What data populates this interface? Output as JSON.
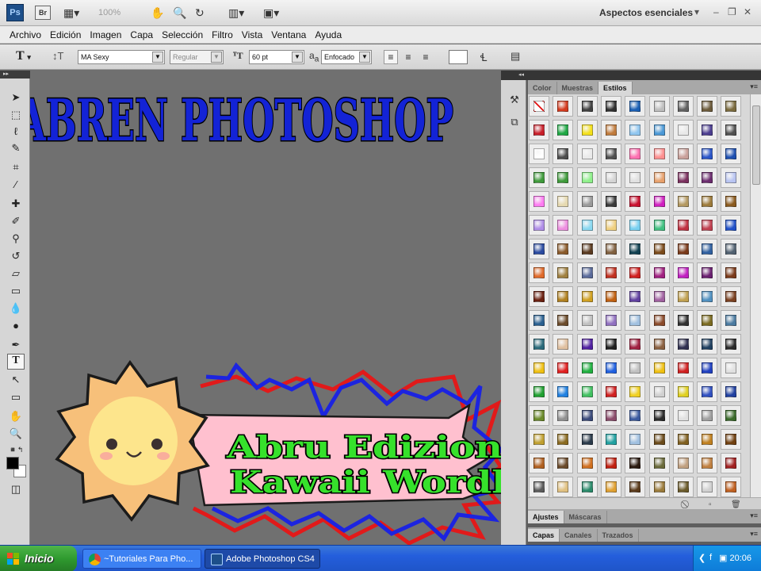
{
  "appbar": {
    "ps_logo": "Ps",
    "br_logo": "Br",
    "zoom": "100%",
    "workspace": "Aspectos esenciales",
    "icons": [
      "screen-mode-icon",
      "hand-icon",
      "zoom-icon",
      "rotate-view-icon",
      "arrange-documents-icon",
      "screen-mode-icon"
    ]
  },
  "menu": [
    "Archivo",
    "Edición",
    "Imagen",
    "Capa",
    "Selección",
    "Filtro",
    "Vista",
    "Ventana",
    "Ayuda"
  ],
  "options": {
    "tool_glyph": "T",
    "font_family": "MA Sexy",
    "font_style": "Regular",
    "font_size": "60 pt",
    "aa_label": "a",
    "antialias": "Enfocado"
  },
  "canvas": {
    "title_text": "ABREN PHOTOSHOP",
    "sticker_line1": "Abru Edizion",
    "sticker_line2": "Kawaii Wordl",
    "colors": {
      "canvas_bg": "#707070",
      "title_fill": "#1323d6",
      "sticker_fill": "#36e12b",
      "banner_pink": "#ffc0cf",
      "zigzag_red": "#e11a1a",
      "zigzag_blue": "#1c24e0",
      "sun": "#f7c07a",
      "sun_face": "#fde58c"
    }
  },
  "panels": {
    "styles_tabs": [
      "Color",
      "Muestras",
      "Estilos"
    ],
    "adjust_tabs": [
      "Ajustes",
      "Máscaras"
    ],
    "layers_tabs": [
      "Capas",
      "Canales",
      "Trazados"
    ],
    "swatch_colors": [
      [
        "#ffffff",
        "#d43a1e",
        "#404040",
        "#303030",
        "#1a5fb4",
        "#bdbdbd",
        "#606060",
        "#6b5a3a",
        "#7a6a3d"
      ],
      [
        "#c81f2a",
        "#1fa844",
        "#f4e01a",
        "#c07b3c",
        "#8fc6f0",
        "#4a98d6",
        "#e8e8e8",
        "#4b3d8f",
        "#505050"
      ],
      [
        "#ffffff",
        "#4c4c4c",
        "#eaeaea",
        "#4e4e4e",
        "#ff6fb0",
        "#ff8f8f",
        "#c9a09a",
        "#2a55c8",
        "#1d4fb0"
      ],
      [
        "#3e9a3a",
        "#3e9a3a",
        "#8ef08a",
        "#d4d4d4",
        "#e0e0e0",
        "#e7a06b",
        "#7a2f5d",
        "#6b2c6e",
        "#b8c4f2"
      ],
      [
        "#ff7cf2",
        "#e6d9b0",
        "#9a9a9a",
        "#3a3a3a",
        "#c8102e",
        "#d020c0",
        "#b39860",
        "#9c7a3a",
        "#8a5a1e"
      ],
      [
        "#b08ee8",
        "#ee8ee0",
        "#8ad8f0",
        "#f0d080",
        "#78d0f0",
        "#40c080",
        "#c03040",
        "#c04050",
        "#2050c8"
      ],
      [
        "#2a4aa0",
        "#8a5a2a",
        "#5a3a20",
        "#806040",
        "#104050",
        "#7a4a1a",
        "#7a3a1a",
        "#3060a0",
        "#506070"
      ],
      [
        "#e06a2a",
        "#a08040",
        "#5a6a9a",
        "#c03020",
        "#d02020",
        "#a02080",
        "#c020c0",
        "#6a2070",
        "#7a3a1a"
      ],
      [
        "#6a2010",
        "#b08020",
        "#d0a020",
        "#c06010",
        "#6040a0",
        "#a060a0",
        "#c0a050",
        "#5090c0",
        "#7a4020"
      ],
      [
        "#2a6090",
        "#6a4a2a",
        "#c0c0c0",
        "#9070c0",
        "#a0c0e0",
        "#8a4a2a",
        "#303030",
        "#7a6a20",
        "#4a7aa0"
      ],
      [
        "#2a6a7a",
        "#e0c0a0",
        "#5020a0",
        "#202020",
        "#a02040",
        "#8a6040",
        "#303050",
        "#204060",
        "#2a2a2a"
      ],
      [
        "#f0c010",
        "#e02020",
        "#20b040",
        "#2060e0",
        "#c0c0c0",
        "#f0c010",
        "#d02020",
        "#2040c0",
        "#e0e0e0"
      ],
      [
        "#20a030",
        "#2080e0",
        "#40c060",
        "#d02020",
        "#f0d020",
        "#d0d0d0",
        "#e0d020",
        "#3050c0",
        "#2040a0"
      ],
      [
        "#6a8a2a",
        "#909090",
        "#3a4a7a",
        "#8a4a6a",
        "#3a5aa0",
        "#2a2a2a",
        "#e0e0e0",
        "#a0a0a0",
        "#3a6a2a"
      ],
      [
        "#c0a030",
        "#8a6a20",
        "#2a3a4a",
        "#20a0a0",
        "#a0c0e0",
        "#6a4a1a",
        "#806020",
        "#c08020",
        "#704010"
      ],
      [
        "#b06020",
        "#6a4a2a",
        "#d07020",
        "#c02010",
        "#2a1a10",
        "#6a6a3a",
        "#c0a080",
        "#c08040",
        "#a02020"
      ],
      [
        "#5a5a5a",
        "#e0c080",
        "#2a8a6a",
        "#e0a030",
        "#5a3a1a",
        "#9a7a3a",
        "#6a5a2a",
        "#d0d0d0",
        "#c06020"
      ]
    ]
  },
  "taskbar": {
    "start_label": "Inicio",
    "task1": "~Tutoriales Para Pho...",
    "task2": "Adobe Photoshop CS4",
    "clock": "20:06"
  }
}
